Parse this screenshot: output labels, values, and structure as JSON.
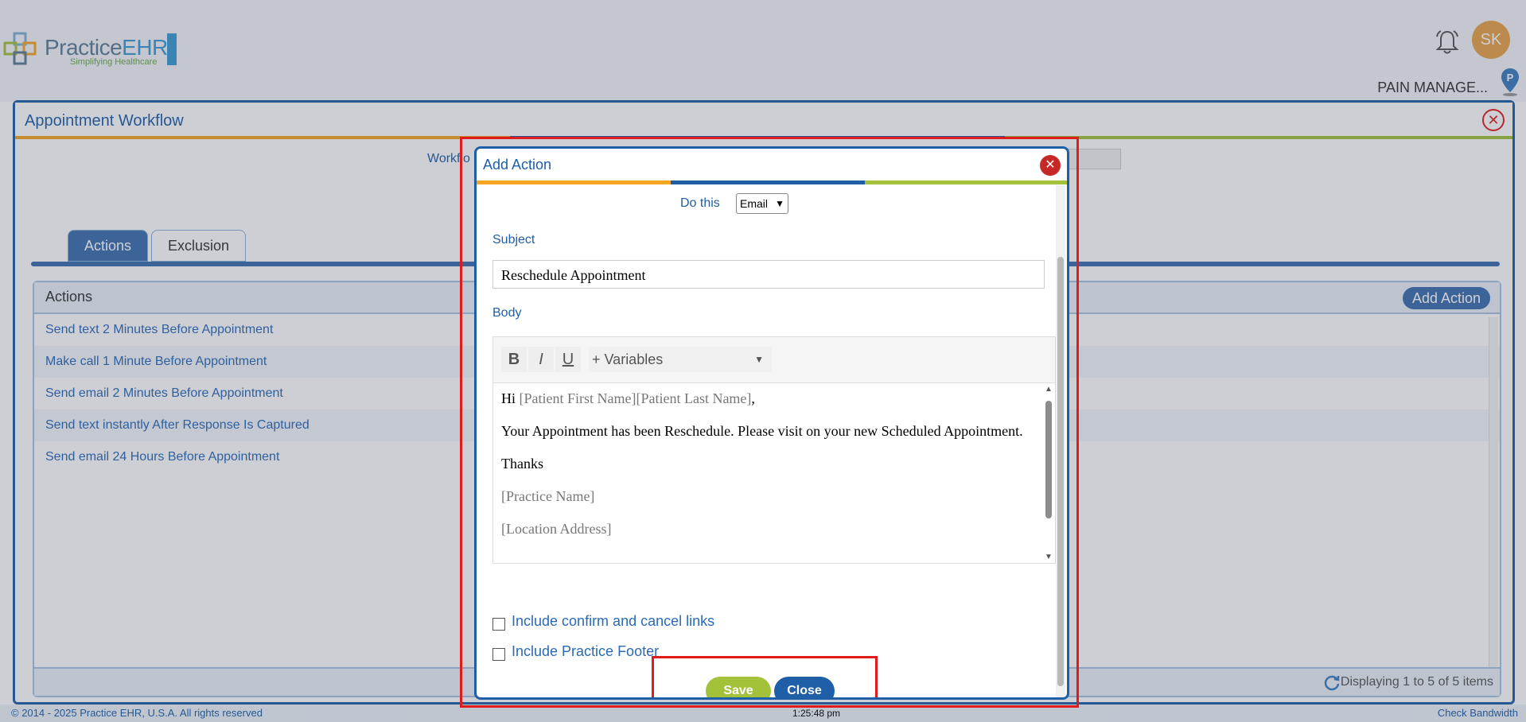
{
  "header": {
    "logo_main": "Practice",
    "logo_accent": "EHR",
    "logo_tagline": "Simplifying Healthcare",
    "avatar_initials": "SK",
    "practice_name": "PAIN MANAGE...",
    "pin_letter": "P"
  },
  "workflow": {
    "title": "Appointment Workflow",
    "workflow_label": "Workflo",
    "tabs": [
      {
        "label": "Actions",
        "active": true
      },
      {
        "label": "Exclusion",
        "active": false
      }
    ],
    "panel_title": "Actions",
    "add_action_label": "Add Action",
    "rows": [
      "Send text 2 Minutes Before Appointment",
      "Make call 1 Minute Before Appointment",
      "Send email 2 Minutes Before Appointment",
      "Send text instantly After Response Is Captured",
      "Send email 24 Hours Before Appointment"
    ],
    "display_count": "Displaying 1 to 5 of 5 items"
  },
  "modal": {
    "title": "Add Action",
    "do_this_label": "Do this",
    "do_this_value": "Email",
    "subject_label": "Subject",
    "subject_value": "Reschedule Appointment",
    "body_label": "Body",
    "toolbar": {
      "bold": "B",
      "italic": "I",
      "underline": "U",
      "variables": "+ Variables"
    },
    "body": {
      "greeting": "Hi ",
      "greeting_vars": "[Patient First Name][Patient Last Name]",
      "greeting_end": ",",
      "line1": "Your Appointment has been Reschedule. Please visit on your new Scheduled Appointment.",
      "line2": "Thanks",
      "line3": "[Practice Name]",
      "line4": "[Location Address]"
    },
    "checkbox1": "Include confirm and cancel links",
    "checkbox2": "Include Practice Footer",
    "save_label": "Save",
    "close_label": "Close"
  },
  "statusbar": {
    "copyright": "© 2014 - 2025 Practice EHR, U.S.A. All rights reserved",
    "clock": "1:25:48 pm",
    "bandwidth": "Check Bandwidth"
  },
  "colors": {
    "brand_blue": "#1e5fa8",
    "stripe_orange": "#f5a623",
    "stripe_blue": "#1e5fa8",
    "stripe_green": "#a4c13a",
    "save_green": "#a4c13a",
    "highlight_red": "#e01b1b"
  }
}
